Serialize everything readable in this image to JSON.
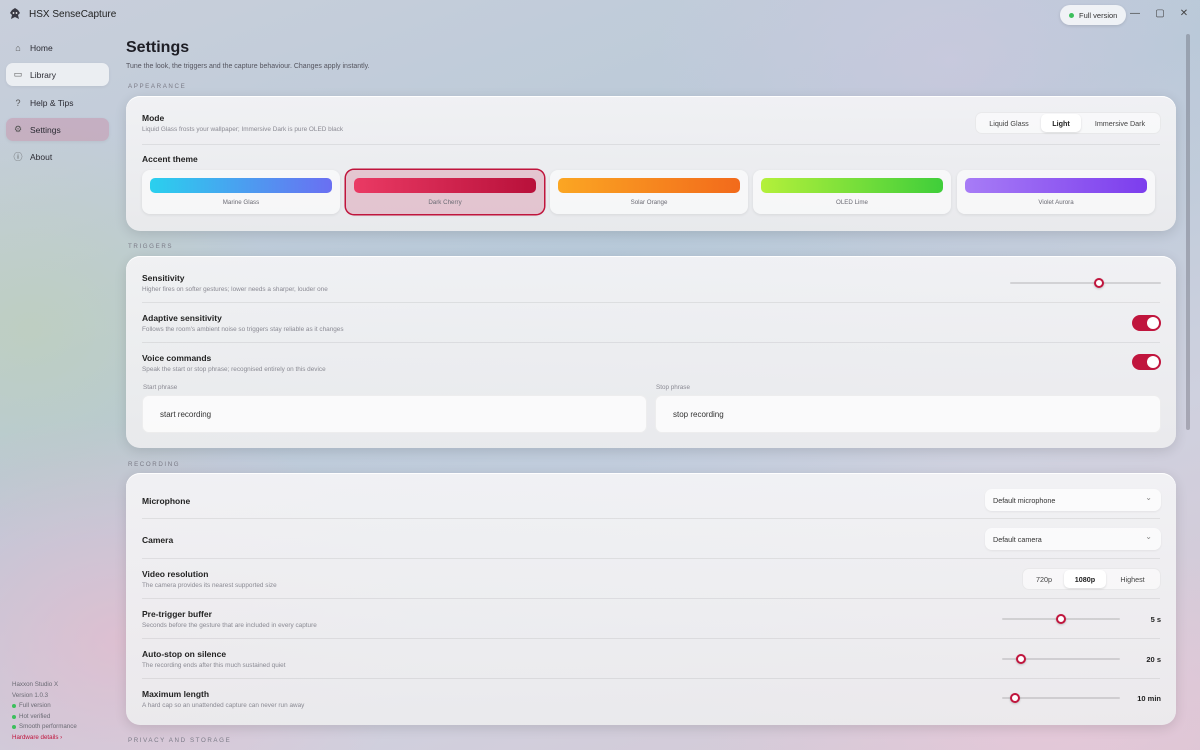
{
  "app": {
    "title": "HSX SenseCapture",
    "badge": "Full version"
  },
  "window_controls": {
    "minimize": "—",
    "maximize": "▢",
    "close": "✕"
  },
  "sidebar": {
    "items": [
      {
        "label": "Home",
        "icon": "home-icon",
        "glyph": "⌂"
      },
      {
        "label": "Library",
        "icon": "folder-icon",
        "glyph": "▭"
      },
      {
        "label": "Help & Tips",
        "icon": "question-icon",
        "glyph": "?"
      },
      {
        "label": "Settings",
        "icon": "gear-icon",
        "glyph": "⚙"
      },
      {
        "label": "About",
        "icon": "info-icon",
        "glyph": "ⓘ"
      }
    ],
    "footer": {
      "company": "Haxxon Studio X",
      "version": "Version 1.0.3",
      "status": [
        "Full version",
        "Hot verified",
        "Smooth performance"
      ],
      "hardware_link": "Hardware details ›"
    }
  },
  "page": {
    "title": "Settings",
    "subtitle": "Tune the look, the triggers and the capture behaviour. Changes apply instantly."
  },
  "appearance": {
    "section": "APPEARANCE",
    "mode_title": "Mode",
    "mode_desc": "Liquid Glass frosts your wallpaper; Immersive Dark is pure OLED black",
    "mode_options": [
      "Liquid Glass",
      "Light",
      "Immersive Dark"
    ],
    "mode_selected": "Light",
    "accent_title": "Accent theme",
    "accents": [
      {
        "name": "Marine Glass",
        "from": "#2ad0ee",
        "to": "#6a6ff2"
      },
      {
        "name": "Dark Cherry",
        "from": "#ea3a64",
        "to": "#b8103a"
      },
      {
        "name": "Solar Orange",
        "from": "#fba623",
        "to": "#f26a1b"
      },
      {
        "name": "OLED Lime",
        "from": "#b4f03a",
        "to": "#3fce3a"
      },
      {
        "name": "Violet Aurora",
        "from": "#a77cf6",
        "to": "#7c3ded"
      }
    ],
    "accent_selected": "Dark Cherry"
  },
  "triggers": {
    "section": "TRIGGERS",
    "sensitivity_title": "Sensitivity",
    "sensitivity_desc": "Higher fires on softer gestures; lower needs a sharper, louder one",
    "sensitivity_value": 0.59,
    "adaptive_title": "Adaptive sensitivity",
    "adaptive_desc": "Follows the room's ambient noise so triggers stay reliable as it changes",
    "adaptive_on": true,
    "voice_title": "Voice commands",
    "voice_desc": "Speak the start or stop phrase; recognised entirely on this device",
    "voice_on": true,
    "start_label": "Start phrase",
    "start_value": "start recording",
    "stop_label": "Stop phrase",
    "stop_value": "stop recording"
  },
  "recording": {
    "section": "RECORDING",
    "mic_title": "Microphone",
    "mic_value": "Default microphone",
    "camera_title": "Camera",
    "camera_value": "Default camera",
    "res_title": "Video resolution",
    "res_desc": "The camera provides its nearest supported size",
    "res_options": [
      "720p",
      "1080p",
      "Highest"
    ],
    "res_selected": "1080p",
    "buffer_title": "Pre-trigger buffer",
    "buffer_desc": "Seconds before the gesture that are included in every capture",
    "buffer_value": "5 s",
    "buffer_level": 0.5,
    "autostop_title": "Auto-stop on silence",
    "autostop_desc": "The recording ends after this much sustained quiet",
    "autostop_value": "20 s",
    "autostop_level": 0.16,
    "maxlen_title": "Maximum length",
    "maxlen_desc": "A hard cap so an unattended capture can never run away",
    "maxlen_value": "10 min",
    "maxlen_level": 0.11
  },
  "privacy": {
    "section": "PRIVACY AND STORAGE"
  },
  "colors": {
    "accent": "#c0153d",
    "status_ok": "#3cbf5c"
  }
}
